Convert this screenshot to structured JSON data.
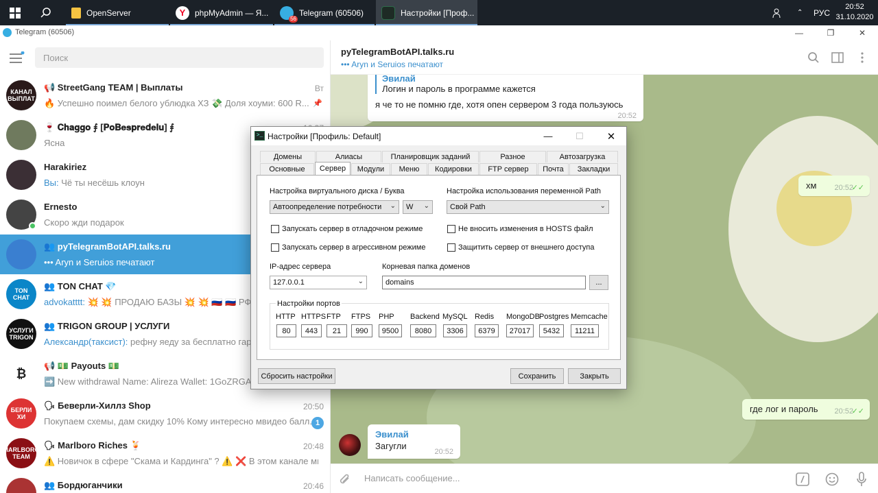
{
  "taskbar": {
    "apps": [
      {
        "label": "OpenServer"
      },
      {
        "label": "phpMyAdmin — Я..."
      },
      {
        "label": "Telegram (60506)",
        "badge": "56"
      },
      {
        "label": "Настройки [Проф..."
      }
    ],
    "lang": "РУС",
    "time": "20:52",
    "date": "31.10.2020"
  },
  "window": {
    "title": "Telegram (60506)"
  },
  "sidebar": {
    "search_placeholder": "Поиск",
    "chats": [
      {
        "title": "📢 StreetGang TEAM | Выплаты",
        "sender": "",
        "preview": "🔥 Успешно поимел белого ублюдка ХЗ 💸 Доля хоуми: 600 R...",
        "time": "Вт",
        "avatar_text": "КАНАЛ ВЫПЛАТ",
        "avatar_color": "#2a1a1a"
      },
      {
        "title": "🍷 𝐂𝐡𝐚𝐠𝐠𝐨 ⨎ [𝐏𝐨𝐁𝐞𝐬𝐩𝐫𝐞𝐝𝐞𝐥𝐮] ⨎",
        "sender": "",
        "preview": "Ясна",
        "time": "16:37",
        "avatar_text": "",
        "avatar_color": "#6f7a5e"
      },
      {
        "title": "Harakiriez",
        "sender": "Вы: ",
        "preview": "Чё ты несёшь клоун",
        "time": "",
        "avatar_text": "",
        "avatar_color": "#3b2f35"
      },
      {
        "title": "Ernesto",
        "sender": "",
        "preview": "Скоро жди подарок",
        "time": "",
        "avatar_text": "",
        "avatar_color": "#444"
      },
      {
        "title": "👥 pyTelegramBotAPI.talks.ru",
        "sender": "",
        "preview": "••• Aryn и Seruios печатают",
        "time": "",
        "avatar_text": "",
        "avatar_color": "#3a7fd0"
      },
      {
        "title": "👥 TON CHAT 💎",
        "sender": "advokatttt: ",
        "preview": "💥 💥 ПРОДАЮ БАЗЫ 💥 💥 🇷🇺 🇷🇺 РФ",
        "time": "",
        "avatar_text": "TON CHAT",
        "avatar_color": "#0b86c8"
      },
      {
        "title": "👥 TRIGON GROUP | УСЛУГИ",
        "sender": "Александр(таксист): ",
        "preview": "рефну яеду за бесплатно гарант",
        "time": "",
        "avatar_text": "УСЛУГИ TRIGON",
        "avatar_color": "#111"
      },
      {
        "title": "📢 💵 Payouts 💵",
        "sender": "",
        "preview": "➡️ New withdrawal Name: Alireza  Wallet: 1GoZRGA4N",
        "time": "",
        "avatar_text": "₿",
        "avatar_color": "#fff"
      },
      {
        "title": "🗣 Беверли-Хиллз Shop",
        "sender": "",
        "preview": "Покупаем схемы, дам скидку 10% Кому интересно мвидео балл...",
        "time": "20:50",
        "badge": "1",
        "avatar_text": "БЕРЛИ ХИ",
        "avatar_color": "#d33"
      },
      {
        "title": "🗣 Marlboro Riches 🍹",
        "sender": "",
        "preview": "⚠️ Новичок в сфере \"Скама и Кардинга\" ? ⚠️ ❌ В этом канале мы т...",
        "time": "20:48",
        "avatar_text": "MARLBORO TEAM",
        "avatar_color": "#8b0f14"
      },
      {
        "title": "👥 Бордюганчики",
        "sender": "",
        "preview": "",
        "time": "20:46",
        "avatar_text": "",
        "avatar_color": "#a33"
      }
    ]
  },
  "chat": {
    "name": "pyTelegramBotAPI.talks.ru",
    "status": "••• Aryn и Seruios печатают",
    "composer_placeholder": "Написать сообщение...",
    "messages": {
      "m1_reply_sender": "Эвилай",
      "m1_reply_text": "Логин и пароль в программе кажется",
      "m1_text": "я че то не помню где, хотя опен сервером 3 года пользуюсь",
      "m1_time": "20:52",
      "m2_text": "хм",
      "m2_time": "20:52",
      "m3_text": "где лог и пароль",
      "m3_time": "20:52",
      "m4_sender": "Эвилай",
      "m4_text": "Загугли",
      "m4_time": "20:52"
    }
  },
  "dialog": {
    "title": "Настройки [Профиль: Default]",
    "tabs_row1": [
      "Домены",
      "Алиасы",
      "Планировщик заданий",
      "Разное",
      "Автозагрузка"
    ],
    "tabs_row2": [
      "Основные",
      "Сервер",
      "Модули",
      "Меню",
      "Кодировки",
      "FTP сервер",
      "Почта",
      "Закладки"
    ],
    "selected_tab": "Сервер",
    "vdisk_label": "Настройка виртуального диска / Буква",
    "vdisk_value": "Автоопределение потребности",
    "drive_letter": "W",
    "path_label": "Настройка использования переменной Path",
    "path_value": "Свой Path",
    "chk_debug": "Запускать сервер в отладочном режиме",
    "chk_aggressive": "Запускать сервер в агрессивном режиме",
    "chk_hosts": "Не вносить изменения в HOSTS файл",
    "chk_protect": "Защитить сервер от внешнего доступа",
    "ip_label": "IP-адрес сервера",
    "ip_value": "127.0.0.1",
    "root_label": "Корневая папка доменов",
    "root_value": "domains",
    "browse_label": "...",
    "ports_title": "Настройки портов",
    "ports": [
      {
        "name": "HTTP",
        "value": "80"
      },
      {
        "name": "HTTPS",
        "value": "443"
      },
      {
        "name": "FTP",
        "value": "21"
      },
      {
        "name": "FTPS",
        "value": "990"
      },
      {
        "name": "PHP",
        "value": "9500"
      },
      {
        "name": "Backend",
        "value": "8080"
      },
      {
        "name": "MySQL",
        "value": "3306"
      },
      {
        "name": "Redis",
        "value": "6379"
      },
      {
        "name": "MongoDB",
        "value": "27017"
      },
      {
        "name": "Postgres",
        "value": "5432"
      },
      {
        "name": "Memcache",
        "value": "11211"
      }
    ],
    "reset_label": "Сбросить настройки",
    "save_label": "Сохранить",
    "close_label": "Закрыть"
  }
}
